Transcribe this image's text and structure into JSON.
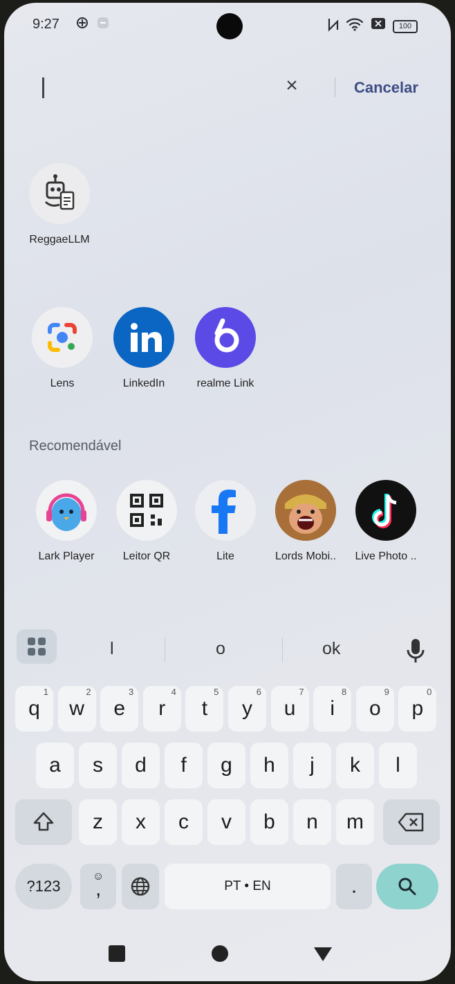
{
  "status": {
    "time": "9:27",
    "battery": "100"
  },
  "search": {
    "value": "",
    "cancel_label": "Cancelar"
  },
  "recent_apps": [
    {
      "label": "ReggaeLLM"
    }
  ],
  "result_apps": [
    {
      "label": "Lens"
    },
    {
      "label": "LinkedIn"
    },
    {
      "label": "realme Link"
    }
  ],
  "recommended": {
    "title": "Recomendável",
    "apps": [
      {
        "label": "Lark Player"
      },
      {
        "label": "Leitor QR"
      },
      {
        "label": "Lite"
      },
      {
        "label": "Lords Mobi.."
      },
      {
        "label": "Live Photo .."
      }
    ]
  },
  "keyboard": {
    "suggestions": [
      "l",
      "o",
      "ok"
    ],
    "row1": [
      {
        "k": "q",
        "n": "1"
      },
      {
        "k": "w",
        "n": "2"
      },
      {
        "k": "e",
        "n": "3"
      },
      {
        "k": "r",
        "n": "4"
      },
      {
        "k": "t",
        "n": "5"
      },
      {
        "k": "y",
        "n": "6"
      },
      {
        "k": "u",
        "n": "7"
      },
      {
        "k": "i",
        "n": "8"
      },
      {
        "k": "o",
        "n": "9"
      },
      {
        "k": "p",
        "n": "0"
      }
    ],
    "row2": [
      "a",
      "s",
      "d",
      "f",
      "g",
      "h",
      "j",
      "k",
      "l"
    ],
    "row3": [
      "z",
      "x",
      "c",
      "v",
      "b",
      "n",
      "m"
    ],
    "symbols_label": "?123",
    "comma_label": ",",
    "space_label": "PT • EN",
    "period_label": "."
  },
  "colors": {
    "accent": "#8fd3cf",
    "cancel": "#3d4d84"
  }
}
